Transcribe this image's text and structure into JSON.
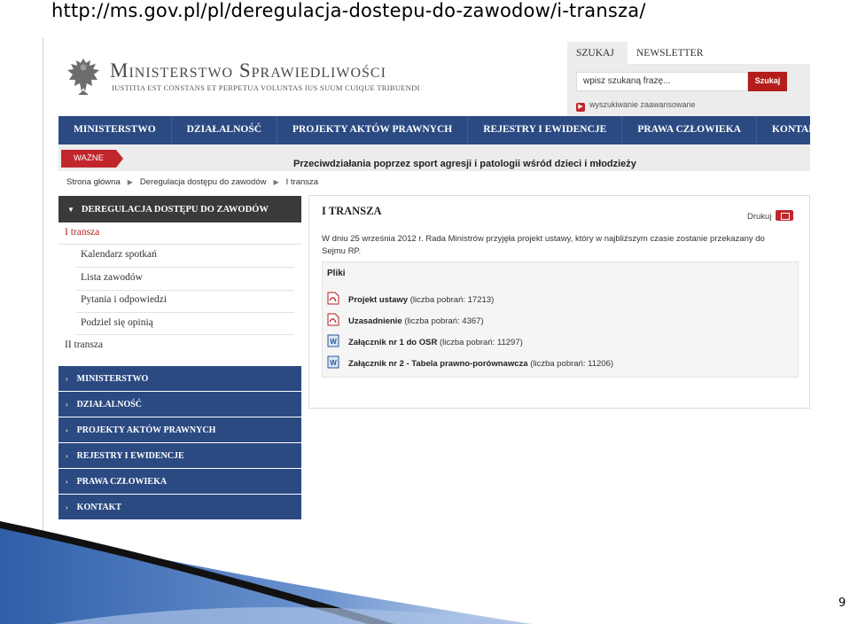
{
  "slide": {
    "url": "http://ms.gov.pl/pl/deregulacja-dostepu-do-zawodow/i-transza/",
    "page_number": "9"
  },
  "header": {
    "org_name": "Ministerstwo Sprawiedliwości",
    "motto": "IUSTITIA EST CONSTANS ET PERPETUA VOLUNTAS IUS SUUM CUIQUE TRIBUENDI"
  },
  "search": {
    "tab_search": "SZUKAJ",
    "tab_newsletter": "NEWSLETTER",
    "placeholder": "wpisz szukaną frazę...",
    "button": "Szukaj",
    "advanced": "wyszukiwanie zaawansowane"
  },
  "main_nav": [
    "MINISTERSTWO",
    "DZIAŁALNOŚĆ",
    "PROJEKTY AKTÓW PRAWNYCH",
    "REJESTRY I EWIDENCJE",
    "PRAWA CZŁOWIEKA",
    "KONTAKT"
  ],
  "ticker": {
    "badge": "WAŻNE",
    "text": "Przeciwdziałania poprzez sport agresji i patologii wśród dzieci i młodzieży"
  },
  "breadcrumb": [
    "Strona główna",
    "Deregulacja dostępu do zawodów",
    "I transza"
  ],
  "sidebar": {
    "heading": "DEREGULACJA DOSTĘPU DO ZAWODÓW",
    "current": "I transza",
    "sub_items": [
      "Kalendarz spotkań",
      "Lista zawodów",
      "Pytania i odpowiedzi",
      "Podziel się opinią"
    ],
    "second": "II transza",
    "nav_buttons": [
      "MINISTERSTWO",
      "DZIAŁALNOŚĆ",
      "PROJEKTY AKTÓW PRAWNYCH",
      "REJESTRY I EWIDENCJE",
      "PRAWA CZŁOWIEKA",
      "KONTAKT"
    ]
  },
  "content": {
    "title": "I TRANSZA",
    "print": "Drukuj",
    "description": "W dniu 25 września 2012 r. Rada Ministrów przyjęła projekt ustawy, który w najbliższym czasie zostanie przekazany do Sejmu RP.",
    "files_title": "Pliki",
    "files": [
      {
        "name": "Projekt ustawy",
        "count": "(liczba pobrań: 17213)",
        "type": "pdf-icon"
      },
      {
        "name": "Uzasadnienie",
        "count": "(liczba pobrań: 4367)",
        "type": "pdf-icon"
      },
      {
        "name": "Załącznik nr 1 do OSR",
        "count": "(liczba pobrań: 11297)",
        "type": "word-doc-icon"
      },
      {
        "name": "Załącznik nr 2 - Tabela prawno-porównawcza",
        "count": "(liczba pobrań: 11206)",
        "type": "word-doc-icon"
      }
    ]
  },
  "colors": {
    "nav_blue": "#2b4a82",
    "accent_red": "#b51d1d",
    "sidebar_dark": "#3a3a3a"
  }
}
